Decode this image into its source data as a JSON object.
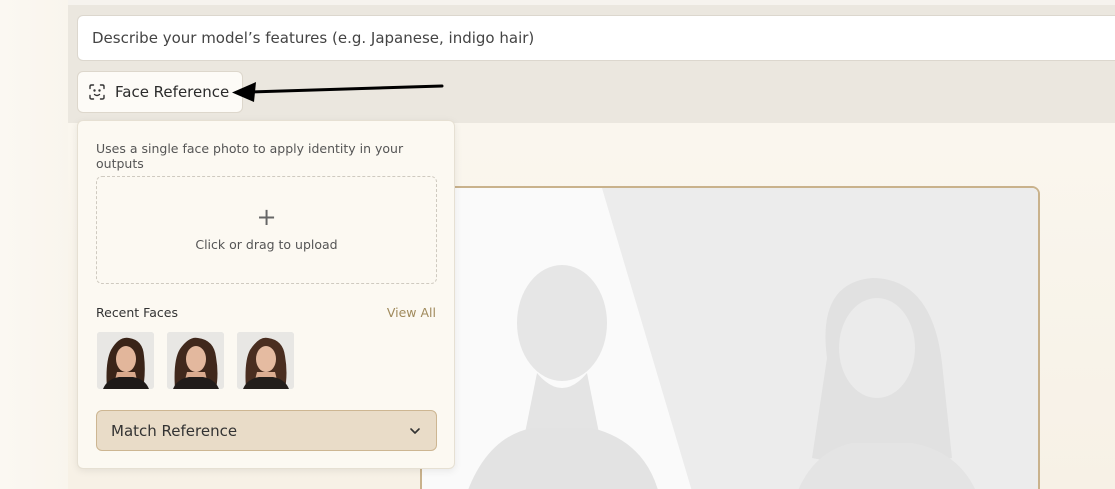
{
  "prompt": {
    "placeholder": "Describe your model’s features (e.g. Japanese, indigo hair)"
  },
  "face_reference": {
    "button_label": "Face Reference",
    "icon": "face-scan-icon"
  },
  "popover": {
    "description": "Uses a single face photo to apply identity in your outputs",
    "upload_text": "Click or drag to upload",
    "upload_icon": "plus-icon",
    "recent_label": "Recent Faces",
    "view_all_label": "View All",
    "recent_faces_count": 3,
    "match_select": {
      "selected": "Match Reference",
      "icon": "chevron-down-icon"
    }
  },
  "colors": {
    "accent_text": "#a08a5c",
    "select_bg": "#e9dcc8",
    "frame_border": "#c9b28c"
  }
}
